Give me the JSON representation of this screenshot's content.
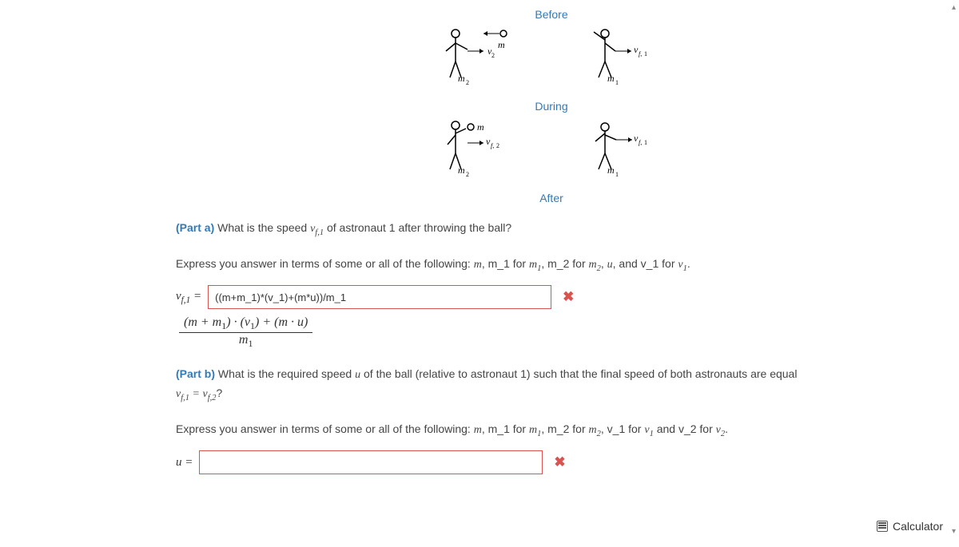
{
  "diagram": {
    "before_label": "Before",
    "during_label": "During",
    "after_label": "After"
  },
  "part_a": {
    "prefix": "(Part a)",
    "question": " What is the speed ",
    "question2": " of astronaut 1 after throwing the ball?",
    "express": "Express you answer in terms of some or all of the following: ",
    "var_label_html": "v_{f,1} =",
    "input_value": "((m+m_1)*(v_1)+(m*u))/m_1"
  },
  "part_b": {
    "prefix": "(Part b)",
    "question": " What is the required speed ",
    "question2": " of the ball (relative to astronaut 1) such that the final speed of both astronauts are equal ",
    "question3": "?",
    "express": "Express you answer in terms of some or all of the following: ",
    "var_label_html": "u =",
    "input_value": ""
  },
  "calculator_label": "Calculator"
}
